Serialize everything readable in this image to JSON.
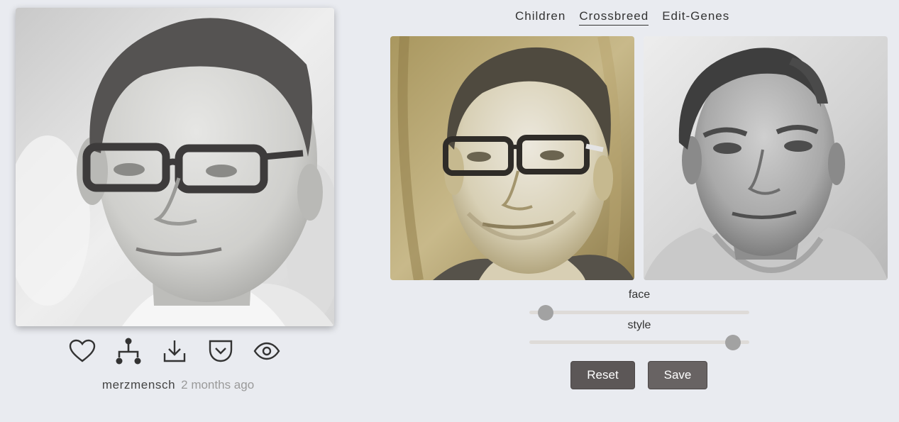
{
  "image": {
    "main_alt": "generated portrait",
    "parent_a_alt": "parent portrait 1",
    "parent_b_alt": "parent portrait 2"
  },
  "actions": [
    {
      "name": "like",
      "icon": "heart-icon"
    },
    {
      "name": "family-tree",
      "icon": "tree-icon"
    },
    {
      "name": "download",
      "icon": "download-icon"
    },
    {
      "name": "pocket",
      "icon": "pocket-icon"
    },
    {
      "name": "view",
      "icon": "eye-icon"
    }
  ],
  "meta": {
    "author": "merzmensch",
    "time": "2 months ago"
  },
  "tabs": [
    {
      "label": "Children",
      "active": false
    },
    {
      "label": "Crossbreed",
      "active": true
    },
    {
      "label": "Edit-Genes",
      "active": false
    }
  ],
  "sliders": {
    "face": {
      "label": "face",
      "value": 0.04
    },
    "style": {
      "label": "style",
      "value": 0.96
    }
  },
  "buttons": {
    "reset": "Reset",
    "save": "Save"
  },
  "colors": {
    "background": "#e9ebf0",
    "button": "#5c5757",
    "slider_thumb": "#a2a2a2",
    "slider_track": "#dedbd8"
  }
}
